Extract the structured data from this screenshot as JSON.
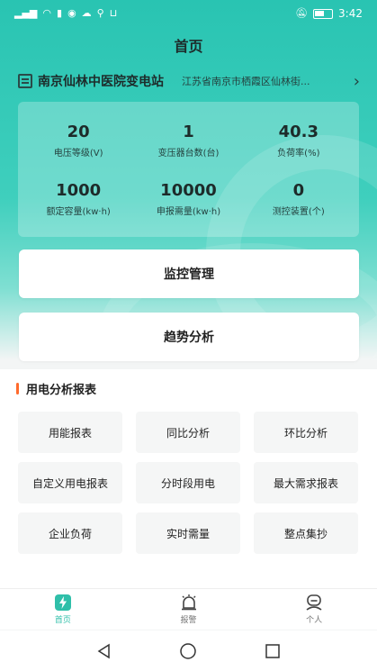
{
  "status_bar": {
    "time": "3:42",
    "left_icons": [
      "signal-icon",
      "wifi-icon",
      "sim-icon",
      "app-icon",
      "cloud-icon",
      "search-icon",
      "cart-icon"
    ],
    "right_icons": [
      "mute-icon",
      "battery-icon"
    ]
  },
  "header": {
    "title": "首页"
  },
  "station": {
    "name": "南京仙林中医院变电站",
    "address": "江苏省南京市栖霞区仙林街..."
  },
  "stats": [
    {
      "value": "20",
      "label": "电压等级(V)"
    },
    {
      "value": "1",
      "label": "变压器台数(台)"
    },
    {
      "value": "40.3",
      "label": "负荷率(%)"
    },
    {
      "value": "1000",
      "label": "额定容量(kw·h)"
    },
    {
      "value": "10000",
      "label": "申报需量(kw·h)"
    },
    {
      "value": "0",
      "label": "测控装置(个)"
    }
  ],
  "actions": {
    "monitor": "监控管理",
    "trend": "趋势分析"
  },
  "reports": {
    "title": "用电分析报表",
    "items": [
      "用能报表",
      "同比分析",
      "环比分析",
      "自定义用电报表",
      "分时段用电",
      "最大需求报表",
      "企业负荷",
      "实时需量",
      "整点集抄"
    ]
  },
  "tabbar": {
    "tabs": [
      {
        "label": "首页",
        "icon": "home-lightning-icon",
        "active": true
      },
      {
        "label": "报警",
        "icon": "alarm-icon",
        "active": false
      },
      {
        "label": "个人",
        "icon": "user-icon",
        "active": false
      }
    ]
  },
  "colors": {
    "accent": "#2fbfa9",
    "marker": "#ff6a2c"
  }
}
